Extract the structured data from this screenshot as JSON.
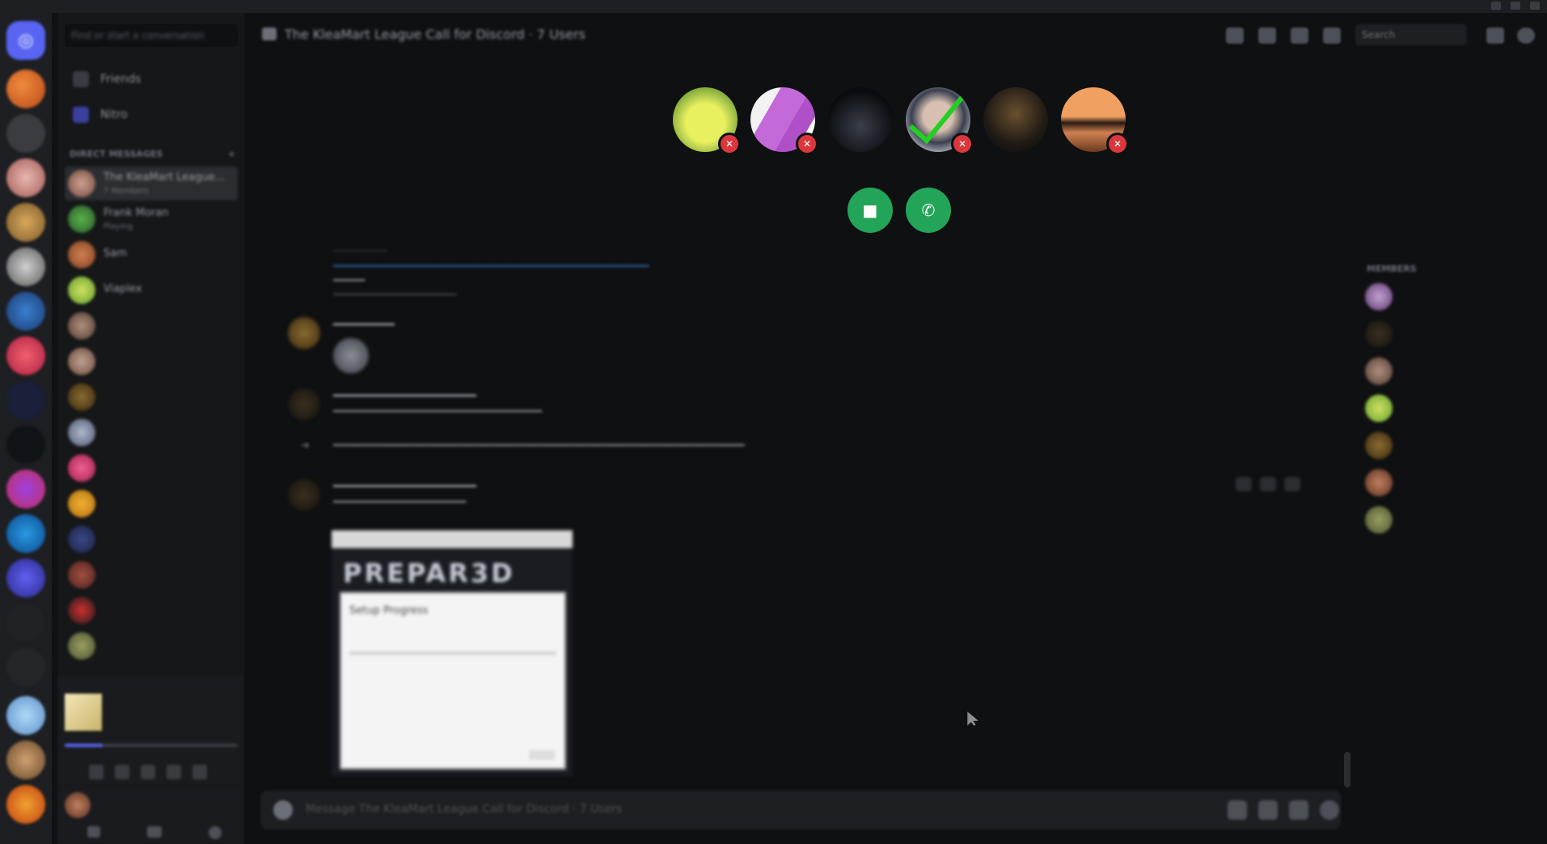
{
  "window": {
    "title": ""
  },
  "colors": {
    "accent": "#5865f2",
    "call_green": "#23a559",
    "mute_red": "#da373c",
    "background": "#0f1012"
  },
  "servers": [
    {
      "name": "home",
      "icon": "discord-logo-icon"
    },
    {
      "name": "server-1"
    },
    {
      "name": "server-2"
    },
    {
      "name": "server-3"
    },
    {
      "name": "server-4"
    },
    {
      "name": "server-5"
    },
    {
      "name": "server-6"
    },
    {
      "name": "server-7"
    },
    {
      "name": "server-8"
    },
    {
      "name": "server-9"
    },
    {
      "name": "server-10"
    },
    {
      "name": "server-11"
    },
    {
      "name": "server-12"
    },
    {
      "name": "server-13"
    },
    {
      "name": "server-14"
    },
    {
      "name": "server-15"
    },
    {
      "name": "server-16"
    },
    {
      "name": "server-17"
    },
    {
      "name": "server-18"
    }
  ],
  "sidebar": {
    "search_placeholder": "Find or start a conversation",
    "nav": [
      {
        "label": "Friends",
        "icon": "friends-icon"
      },
      {
        "label": "Nitro",
        "icon": "nitro-icon"
      }
    ],
    "section_title": "DIRECT MESSAGES",
    "dms": [
      {
        "name": "The KleaMart League...",
        "status": "7 Members"
      },
      {
        "name": "Frank Moran",
        "status": "Playing"
      },
      {
        "name": "Sam",
        "status": ""
      },
      {
        "name": "Viaplex",
        "status": ""
      },
      {
        "name": "",
        "status": ""
      },
      {
        "name": "",
        "status": ""
      },
      {
        "name": "",
        "status": ""
      },
      {
        "name": "",
        "status": ""
      },
      {
        "name": "",
        "status": ""
      },
      {
        "name": "",
        "status": ""
      },
      {
        "name": "",
        "status": ""
      },
      {
        "name": "",
        "status": ""
      },
      {
        "name": "",
        "status": ""
      },
      {
        "name": "",
        "status": ""
      }
    ],
    "player": {
      "track": "",
      "artist": "",
      "progress": 0.22
    }
  },
  "topbar": {
    "title": "The KleaMart League Call for Discord · 7 Users",
    "search_placeholder": "Search",
    "icons": [
      "phone-icon",
      "pin-icon",
      "add-member-icon",
      "members-icon",
      "inbox-icon",
      "help-icon"
    ]
  },
  "call": {
    "participants": [
      {
        "name": "participant-1",
        "muted": true
      },
      {
        "name": "participant-2",
        "muted": true
      },
      {
        "name": "participant-3",
        "muted": false
      },
      {
        "name": "participant-4",
        "muted": true
      },
      {
        "name": "participant-5",
        "muted": false
      },
      {
        "name": "participant-6",
        "muted": true
      }
    ],
    "buttons": {
      "video": "camera-icon",
      "voice": "phone-call-icon"
    }
  },
  "chat": {
    "embed_title": "PREPAR3D",
    "embed_dialog_title": "Setup Progress",
    "composer_placeholder": "Message The KleaMart League Call for Discord · 7 Users"
  },
  "members": {
    "section_title": "MEMBERS",
    "list": [
      {
        "name": "",
        "status": ""
      },
      {
        "name": "",
        "status": ""
      },
      {
        "name": "",
        "status": ""
      },
      {
        "name": "",
        "status": ""
      },
      {
        "name": "",
        "status": ""
      },
      {
        "name": "",
        "status": ""
      },
      {
        "name": "",
        "status": ""
      }
    ]
  }
}
